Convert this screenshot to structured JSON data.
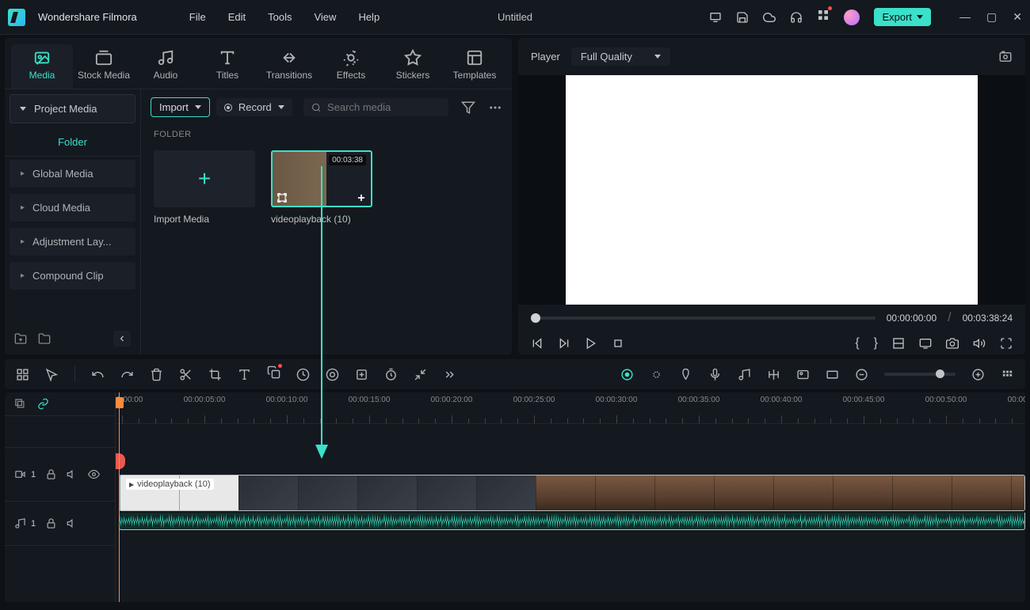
{
  "app_name": "Wondershare Filmora",
  "menus": [
    "File",
    "Edit",
    "Tools",
    "View",
    "Help"
  ],
  "project_title": "Untitled",
  "export_label": "Export",
  "tabs": [
    {
      "id": "media",
      "label": "Media"
    },
    {
      "id": "stock",
      "label": "Stock Media"
    },
    {
      "id": "audio",
      "label": "Audio"
    },
    {
      "id": "titles",
      "label": "Titles"
    },
    {
      "id": "transitions",
      "label": "Transitions"
    },
    {
      "id": "effects",
      "label": "Effects"
    },
    {
      "id": "stickers",
      "label": "Stickers"
    },
    {
      "id": "templates",
      "label": "Templates"
    }
  ],
  "sidebar": {
    "header": "Project Media",
    "active": "Folder",
    "items": [
      "Global Media",
      "Cloud Media",
      "Adjustment Lay...",
      "Compound Clip"
    ]
  },
  "toolbar": {
    "import": "Import",
    "record": "Record",
    "search_placeholder": "Search media"
  },
  "folder_label": "FOLDER",
  "media": {
    "import_label": "Import Media",
    "clip": {
      "duration": "00:03:38",
      "name": "videoplayback (10)"
    }
  },
  "player": {
    "label": "Player",
    "quality": "Full Quality",
    "current": "00:00:00:00",
    "total": "00:03:38:24"
  },
  "ruler": {
    "step": 5,
    "count": 12,
    "format": "00:00:{ss}:00"
  },
  "tracks": {
    "video": "1",
    "audio": "1"
  },
  "clip_label": "videoplayback (10)"
}
